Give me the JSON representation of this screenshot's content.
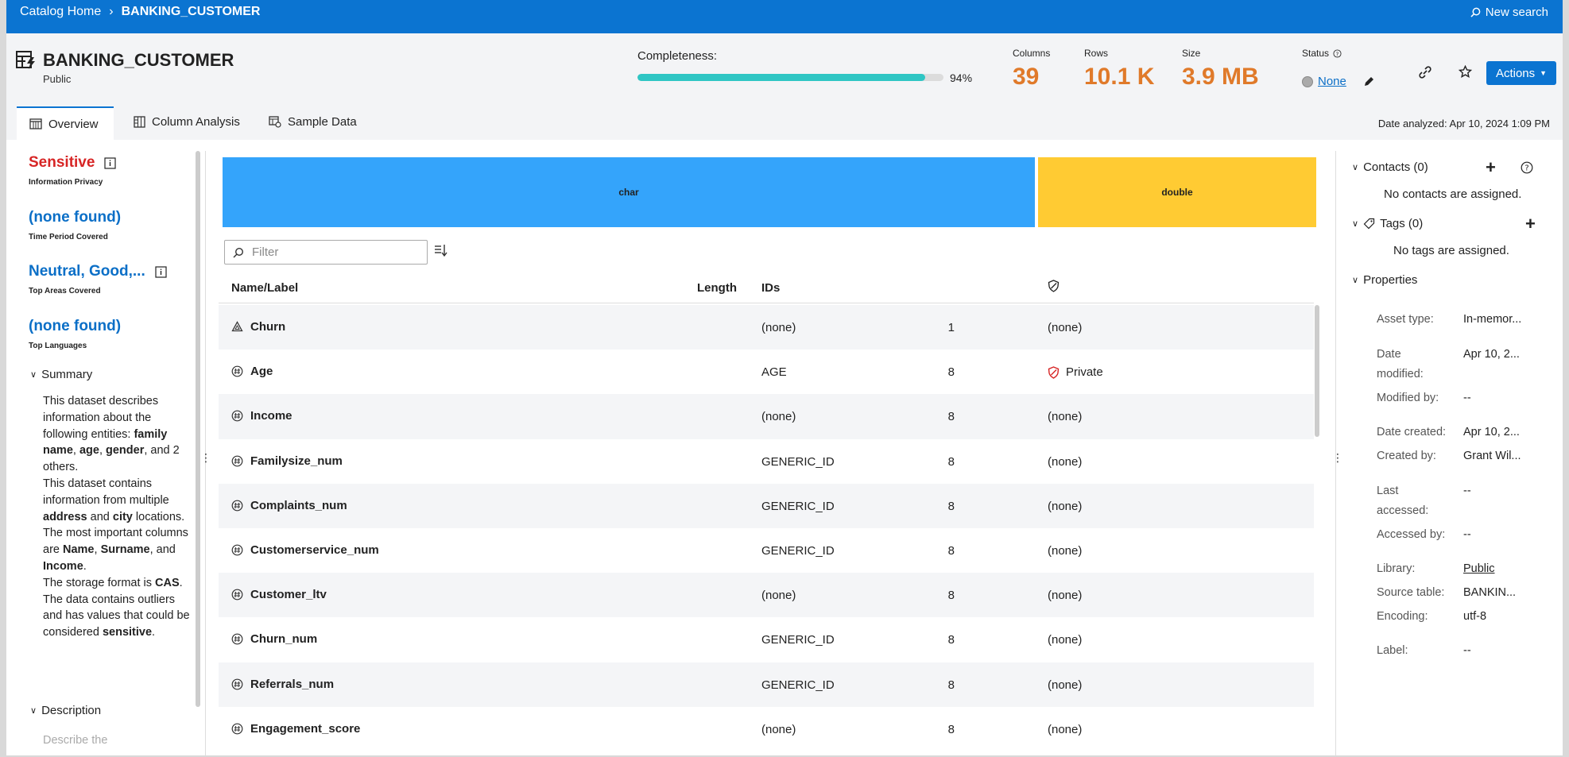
{
  "breadcrumb": {
    "home": "Catalog Home",
    "separator": "›",
    "current": "BANKING_CUSTOMER"
  },
  "new_search": "New search",
  "header": {
    "title": "BANKING_CUSTOMER",
    "subtitle": "Public",
    "completeness_label": "Completeness:",
    "completeness_pct": "94%",
    "completeness_value": 0.94,
    "columns_label": "Columns",
    "columns": "39",
    "rows_label": "Rows",
    "rows": "10.1 K",
    "size_label": "Size",
    "size": "3.9 MB",
    "status_label": "Status",
    "status_value": "None",
    "actions_label": "Actions"
  },
  "tabs": [
    {
      "label": "Overview",
      "icon": "overview-icon"
    },
    {
      "label": "Column Analysis",
      "icon": "column-analysis-icon"
    },
    {
      "label": "Sample Data",
      "icon": "sample-data-icon"
    }
  ],
  "date_analyzed": "Date analyzed: Apr 10, 2024 1:09 PM",
  "left_panel": {
    "sensitive": "Sensitive",
    "sensitive_sub": "Information Privacy",
    "time_value": "(none found)",
    "time_sub": "Time Period Covered",
    "areas_value": "Neutral, Good,...",
    "areas_sub": "Top Areas Covered",
    "lang_value": "(none found)",
    "lang_sub": "Top Languages",
    "summary_label": "Summary",
    "description_label": "Description",
    "description_placeholder": "Describe the",
    "summary": {
      "s1a": "This dataset describes information about the following entities: ",
      "e1": "family name",
      "c1": ", ",
      "e2": "age",
      "c2": ", ",
      "e3": "gender",
      "s1b": ", and 2 others.",
      "s2a": "This dataset contains information from multiple ",
      "e4": "address",
      "s2b": " and ",
      "e5": "city",
      "s2c": " locations.",
      "s3a": "The most important columns are ",
      "e6": "Name",
      "c3": ", ",
      "e7": "Surname",
      "s3b": ", and ",
      "e8": "Income",
      "s3c": ".",
      "s4a": "The storage format is ",
      "e9": "CAS",
      "s4b": ".",
      "s5a": "The data contains outliers and has values that could be considered ",
      "e10": "sensitive",
      "s5b": "."
    }
  },
  "treemap": [
    {
      "label": "char",
      "color": "#34a4fb"
    },
    {
      "label": "double",
      "color": "#ffcb33"
    }
  ],
  "filter_placeholder": "Filter",
  "table": {
    "headers": {
      "name": "Name/Label",
      "length": "Length",
      "ids": "IDs"
    },
    "rows": [
      {
        "name": "Churn",
        "icon": "category-icon",
        "length": "1",
        "ids": "(none)",
        "sensitivity": "(none)"
      },
      {
        "name": "Age",
        "icon": "numeric-icon",
        "length": "8",
        "ids": "AGE",
        "sensitivity": "Private"
      },
      {
        "name": "Income",
        "icon": "numeric-icon",
        "length": "8",
        "ids": "(none)",
        "sensitivity": "(none)"
      },
      {
        "name": "Familysize_num",
        "icon": "numeric-icon",
        "length": "8",
        "ids": "GENERIC_ID",
        "sensitivity": "(none)"
      },
      {
        "name": "Complaints_num",
        "icon": "numeric-icon",
        "length": "8",
        "ids": "GENERIC_ID",
        "sensitivity": "(none)"
      },
      {
        "name": "Customerservice_num",
        "icon": "numeric-icon",
        "length": "8",
        "ids": "GENERIC_ID",
        "sensitivity": "(none)"
      },
      {
        "name": "Customer_ltv",
        "icon": "numeric-icon",
        "length": "8",
        "ids": "(none)",
        "sensitivity": "(none)"
      },
      {
        "name": "Churn_num",
        "icon": "numeric-icon",
        "length": "8",
        "ids": "GENERIC_ID",
        "sensitivity": "(none)"
      },
      {
        "name": "Referrals_num",
        "icon": "numeric-icon",
        "length": "8",
        "ids": "GENERIC_ID",
        "sensitivity": "(none)"
      },
      {
        "name": "Engagement_score",
        "icon": "numeric-icon",
        "length": "8",
        "ids": "(none)",
        "sensitivity": "(none)"
      }
    ]
  },
  "right_panel": {
    "contacts_label": "Contacts (0)",
    "contacts_empty": "No contacts are assigned.",
    "tags_label": "Tags (0)",
    "tags_empty": "No tags are assigned.",
    "properties_label": "Properties",
    "properties": [
      {
        "key": "Asset type:",
        "value": "In-memor..."
      },
      {
        "key": "Date modified:",
        "value": "Apr 10, 2..."
      },
      {
        "key": "Modified by:",
        "value": "--"
      },
      {
        "key": "Date created:",
        "value": "Apr 10, 2..."
      },
      {
        "key": "Created by:",
        "value": "Grant Wil..."
      },
      {
        "key": "Last accessed:",
        "value": "--"
      },
      {
        "key": "Accessed by:",
        "value": "--"
      },
      {
        "key": "Library:",
        "value": "Public"
      },
      {
        "key": "Source table:",
        "value": "BANKIN..."
      },
      {
        "key": "Encoding:",
        "value": "utf-8"
      },
      {
        "key": "Label:",
        "value": "--"
      }
    ]
  },
  "colors": {
    "brand": "#0b74d1",
    "accent_orange": "#e07a2a",
    "sensitive_red": "#d72525",
    "link_blue": "#0b6fc7",
    "completeness": "#2fc6c4"
  }
}
